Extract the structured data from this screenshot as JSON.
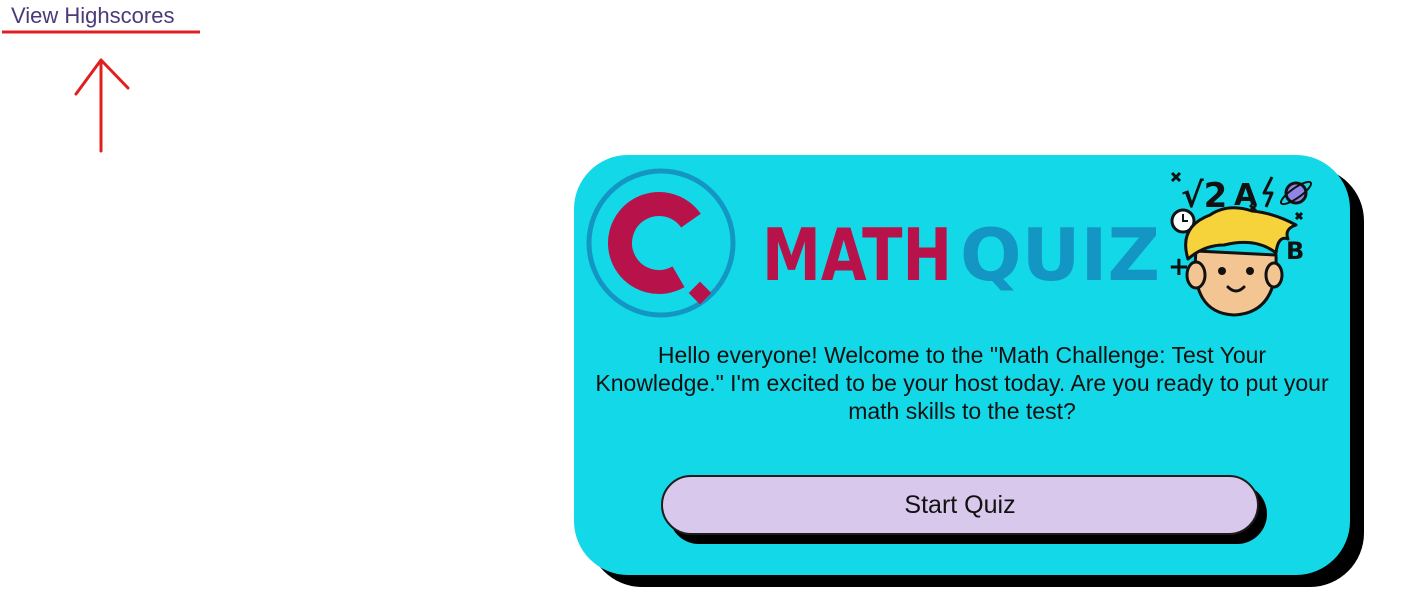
{
  "nav": {
    "highscores_label": "View Highscores"
  },
  "logo": {
    "word1": "MATH",
    "word2": "QUIZ",
    "badge_letter": "Q",
    "sticker_symbols": {
      "sqrt": "√2",
      "letter_a": "A",
      "letter_b": "B",
      "plus": "+"
    }
  },
  "intro": {
    "text": "Hello everyone! Welcome to the \"Math Challenge: Test Your Knowledge.\" I'm excited to be your host today. Are you ready to put your math skills to the test?"
  },
  "start": {
    "label": "Start Quiz"
  },
  "colors": {
    "card": "#13d8e8",
    "math_word": "#b8124a",
    "quiz_word": "#1496c4",
    "button": "#d7c8ec",
    "link": "#4b3a7a",
    "annotation": "#e02020"
  }
}
